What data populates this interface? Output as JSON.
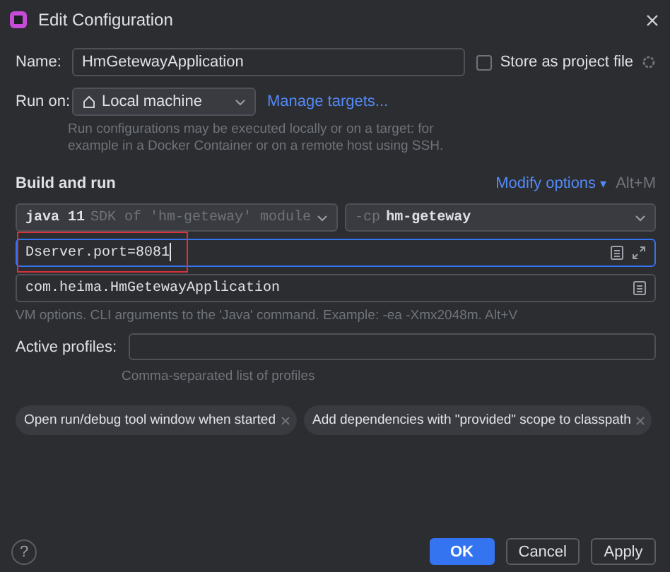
{
  "window": {
    "title": "Edit Configuration"
  },
  "name": {
    "label": "Name:",
    "value": "HmGetewayApplication"
  },
  "store_as_project_file": {
    "label": "Store as project file",
    "checked": false
  },
  "run_on": {
    "label": "Run on:",
    "value": "Local machine",
    "link": "Manage targets...",
    "hint": "Run configurations may be executed locally or on a target: for example in a Docker Container or on a remote host using SSH."
  },
  "build_and_run": {
    "title": "Build and run",
    "modify_options": "Modify options",
    "modify_caret": "▾",
    "shortcut": "Alt+M",
    "jdk": {
      "version": "java 11",
      "detail": "SDK of 'hm-geteway' module"
    },
    "classpath": {
      "flag": "-cp",
      "module": "hm-geteway"
    },
    "vm_options": {
      "value": "Dserver.port=8081",
      "focused": true
    },
    "main_class": {
      "value": "com.heima.HmGetewayApplication"
    },
    "hint": "VM options. CLI arguments to the 'Java' command. Example: -ea -Xmx2048m. Alt+V"
  },
  "active_profiles": {
    "label": "Active profiles:",
    "hint": "Comma-separated list of profiles"
  },
  "options": [
    {
      "label": "Open run/debug tool window when started"
    },
    {
      "label": "Add dependencies with \"provided\" scope to classpath"
    }
  ],
  "help": "?",
  "buttons": [
    {
      "label": "OK",
      "kind": "primary"
    },
    {
      "label": "Cancel",
      "kind": "secondary"
    },
    {
      "label": "Apply",
      "kind": "secondary"
    }
  ]
}
